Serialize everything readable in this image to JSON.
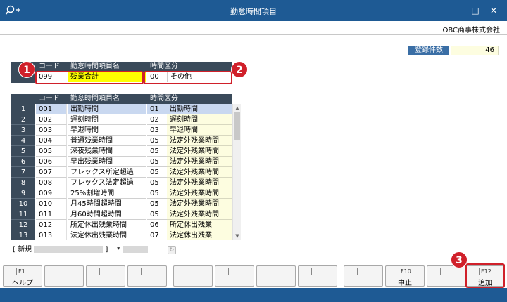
{
  "window": {
    "title": "勤怠時間項目",
    "company": "OBC商事株式会社",
    "controls": {
      "minimize": "‒",
      "maximize": "□",
      "close": "✕"
    }
  },
  "count": {
    "label": "登録件数",
    "value": "46"
  },
  "edit_row": {
    "headers": {
      "code": "コード",
      "name": "勤怠時間項目名",
      "kubun": "時間区分"
    },
    "code": "099",
    "name": "残業合計",
    "kubun_code": "00",
    "kubun_name": "その他"
  },
  "grid": {
    "headers": {
      "code": "コード",
      "name": "勤怠時間項目名",
      "kubun": "時間区分"
    },
    "rows": [
      {
        "num": "1",
        "code": "001",
        "name": "出勤時間",
        "kcode": "01",
        "kname": "出勤時間"
      },
      {
        "num": "2",
        "code": "002",
        "name": "遅刻時間",
        "kcode": "02",
        "kname": "遅刻時間"
      },
      {
        "num": "3",
        "code": "003",
        "name": "早退時間",
        "kcode": "03",
        "kname": "早退時間"
      },
      {
        "num": "4",
        "code": "004",
        "name": "普通残業時間",
        "kcode": "05",
        "kname": "法定外残業時間"
      },
      {
        "num": "5",
        "code": "005",
        "name": "深夜残業時間",
        "kcode": "05",
        "kname": "法定外残業時間"
      },
      {
        "num": "6",
        "code": "006",
        "name": "早出残業時間",
        "kcode": "05",
        "kname": "法定外残業時間"
      },
      {
        "num": "7",
        "code": "007",
        "name": "フレックス所定超過",
        "kcode": "05",
        "kname": "法定外残業時間"
      },
      {
        "num": "8",
        "code": "008",
        "name": "フレックス法定超過",
        "kcode": "05",
        "kname": "法定外残業時間"
      },
      {
        "num": "9",
        "code": "009",
        "name": "25%割増時間",
        "kcode": "05",
        "kname": "法定外残業時間"
      },
      {
        "num": "10",
        "code": "010",
        "name": "月45時間超時間",
        "kcode": "05",
        "kname": "法定外残業時間"
      },
      {
        "num": "11",
        "code": "011",
        "name": "月60時間超時間",
        "kcode": "05",
        "kname": "法定外残業時間"
      },
      {
        "num": "12",
        "code": "012",
        "name": "所定休出残業時間",
        "kcode": "06",
        "kname": "所定休出残業"
      },
      {
        "num": "13",
        "code": "013",
        "name": "法定休出残業時間",
        "kcode": "07",
        "kname": "法定休出残業"
      }
    ]
  },
  "status": {
    "prefix": "[ 新規",
    "suffix": "]",
    "asterisk": "*"
  },
  "fkeys": [
    {
      "key": "F1",
      "label": "ヘルプ"
    },
    {
      "key": "",
      "label": ""
    },
    {
      "key": "",
      "label": ""
    },
    {
      "key": "",
      "label": ""
    },
    {
      "key": "",
      "label": ""
    },
    {
      "key": "",
      "label": ""
    },
    {
      "key": "",
      "label": ""
    },
    {
      "key": "",
      "label": ""
    },
    {
      "key": "",
      "label": ""
    },
    {
      "key": "F10",
      "label": "中止"
    },
    {
      "key": "",
      "label": ""
    },
    {
      "key": "F12",
      "label": "追加"
    }
  ],
  "callouts": [
    "1",
    "2",
    "3"
  ],
  "colors": {
    "titlebar": "#1e5a94",
    "header": "#3a4a5a",
    "highlight": "#ffff00",
    "callout": "#d0202a",
    "selected": "#c9d8f0"
  }
}
